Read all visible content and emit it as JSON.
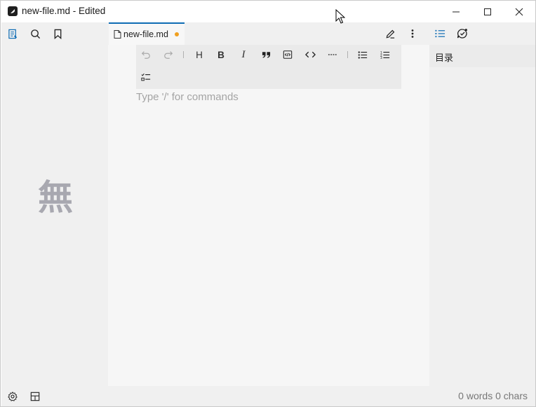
{
  "window": {
    "title": "new-file.md - Edited",
    "app_icon": "app-logo-icon",
    "controls": [
      "minimize-icon",
      "maximize-icon",
      "close-icon"
    ]
  },
  "left_sidebar": {
    "tabs": [
      {
        "name": "files-icon",
        "active": true
      },
      {
        "name": "search-icon",
        "active": false
      },
      {
        "name": "bookmark-icon",
        "active": false
      }
    ],
    "empty_glyph": "無"
  },
  "editor": {
    "tab": {
      "label": "new-file.md",
      "modified": true
    },
    "tab_actions": [
      "edit-pen-icon",
      "more-vertical-icon"
    ],
    "toolbar": {
      "row1": [
        "undo-icon",
        "redo-icon",
        "heading-icon",
        "bold-icon",
        "italic-icon",
        "quote-icon",
        "code-block-icon",
        "inline-code-icon",
        "horizontal-rule-icon",
        "bullet-list-icon",
        "ordered-list-icon"
      ],
      "row2": [
        "task-list-icon"
      ],
      "heading_label": "H",
      "bold_label": "B",
      "italic_label": "I"
    },
    "placeholder": "Type '/' for commands"
  },
  "right_sidebar": {
    "tabs": [
      {
        "name": "outline-icon",
        "active": true
      },
      {
        "name": "chat-icon",
        "active": false
      }
    ],
    "title": "目录"
  },
  "status_bar": {
    "buttons": [
      "settings-icon",
      "layout-icon"
    ],
    "word_count": "0 words 0 chars"
  },
  "colors": {
    "accent": "#0e6cb4",
    "modified_dot": "#f0a020"
  }
}
